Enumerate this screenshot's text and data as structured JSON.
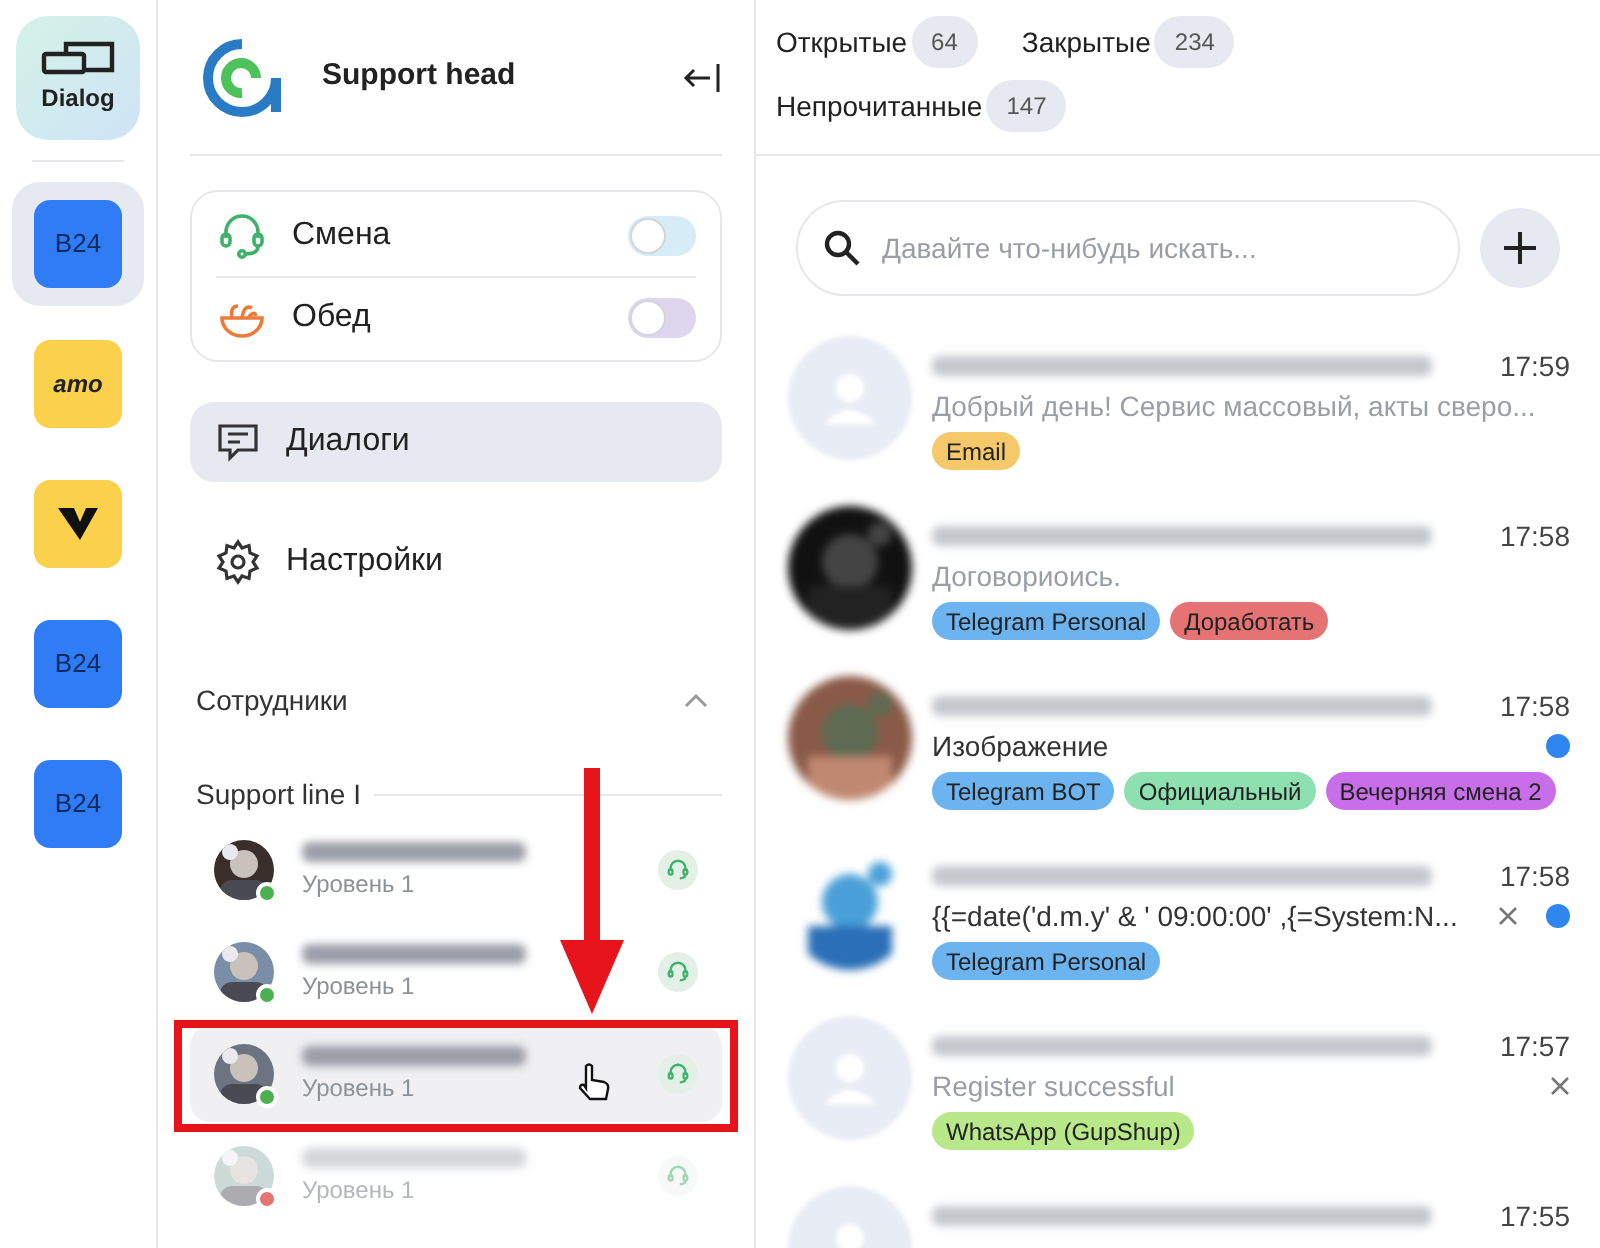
{
  "rail": {
    "logo": {
      "label": "Dialog"
    },
    "items": [
      {
        "kind": "b24",
        "label": "B24",
        "selected": true
      },
      {
        "kind": "amo",
        "label": "amo",
        "selected": false
      },
      {
        "kind": "check",
        "selected": false
      },
      {
        "kind": "b24",
        "label": "B24",
        "selected": false
      },
      {
        "kind": "b24",
        "label": "B24",
        "selected": false
      }
    ]
  },
  "sidebar": {
    "title": "Support head",
    "statuses": [
      {
        "kind": "shift",
        "label": "Смена",
        "on": false,
        "color": "#d6ecf7"
      },
      {
        "kind": "lunch",
        "label": "Обед",
        "on": false,
        "color": "#ddd6ee"
      }
    ],
    "nav": [
      {
        "kind": "dialogs",
        "label": "Диалоги",
        "selected": true
      },
      {
        "kind": "settings",
        "label": "Настройки",
        "selected": false
      }
    ],
    "employees": {
      "title": "Сотрудники",
      "expanded": true,
      "groups": [
        {
          "title": "Support line I",
          "members": [
            {
              "level_text": "Уровень 1",
              "selected": false,
              "disabled": false,
              "color": "#4caf50"
            },
            {
              "level_text": "Уровень 1",
              "selected": false,
              "disabled": false,
              "color": "#4caf50"
            },
            {
              "level_text": "Уровень 1",
              "selected": true,
              "disabled": false,
              "color": "#4caf50"
            },
            {
              "level_text": "Уровень 1",
              "selected": false,
              "disabled": true,
              "color": "#e57373"
            }
          ]
        }
      ]
    }
  },
  "filters": [
    {
      "label": "Открытые",
      "count": "64"
    },
    {
      "label": "Закрытые",
      "count": "234"
    },
    {
      "label": "Непрочитанные",
      "count": "147"
    }
  ],
  "search": {
    "placeholder": "Давайте что-нибудь искать..."
  },
  "chats": [
    {
      "kind": "placeholder",
      "time": "17:59",
      "preview": "Добрый день! Сервис массовый, акты сверо...",
      "unread": false,
      "closable": false,
      "tags": [
        {
          "label": "Email",
          "color": "#f5c86a"
        }
      ]
    },
    {
      "kind": "picture",
      "time": "17:58",
      "preview": "Договориоись.",
      "unread": false,
      "closable": false,
      "tags": [
        {
          "label": "Telegram Personal",
          "color": "#6cb4f0"
        },
        {
          "label": "Доработать",
          "color": "#e57373"
        }
      ]
    },
    {
      "kind": "picture",
      "time": "17:58",
      "preview": "Изображение",
      "unread": true,
      "closable": false,
      "tags": [
        {
          "label": "Telegram BOT",
          "color": "#6cb4f0"
        },
        {
          "label": "Официальный",
          "color": "#8ee0b0"
        },
        {
          "label": "Вечерняя смена 2",
          "color": "#c86ee8"
        }
      ]
    },
    {
      "kind": "picture",
      "time": "17:58",
      "preview": "{{=date('d.m.y' & ' 09:00:00' ,{=System:N...",
      "unread": true,
      "closable": true,
      "tags": [
        {
          "label": "Telegram Personal",
          "color": "#6cb4f0"
        }
      ]
    },
    {
      "kind": "placeholder",
      "time": "17:57",
      "preview": "Register successful",
      "unread": false,
      "closable": true,
      "tags": [
        {
          "label": "WhatsApp (GupShup)",
          "color": "#b8e88a"
        }
      ]
    },
    {
      "kind": "placeholder",
      "time": "17:55"
    }
  ]
}
